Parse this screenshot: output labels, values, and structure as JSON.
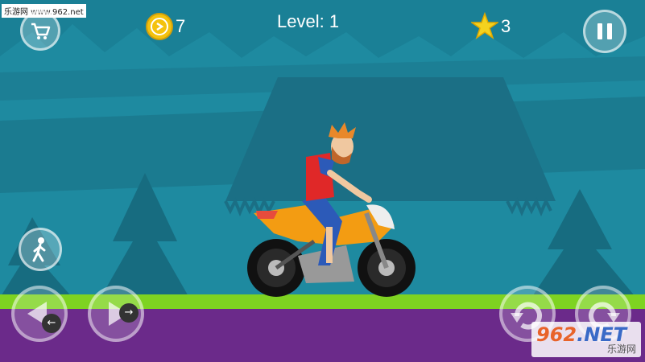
{
  "watermark": "乐游网 www.962.net",
  "hud": {
    "coins": "7",
    "level": "Level: 1",
    "stars": "3"
  },
  "controls": {
    "brake_arrow": "←",
    "gas_arrow": "→"
  },
  "logo": {
    "main_a": "962",
    "main_b": ".NET",
    "sub": "乐游网"
  },
  "colors": {
    "sky": "#1e8aa0",
    "ground_grass": "#7ed321",
    "ground_soil": "#6b2a8a",
    "bike": "#f39c12",
    "coin": "#f4c20d"
  },
  "icons": {
    "shop": "cart-icon",
    "pause": "pause-icon",
    "dismount": "walking-person-icon",
    "tilt_back": "rotate-left-icon",
    "tilt_forward": "rotate-right-icon"
  }
}
